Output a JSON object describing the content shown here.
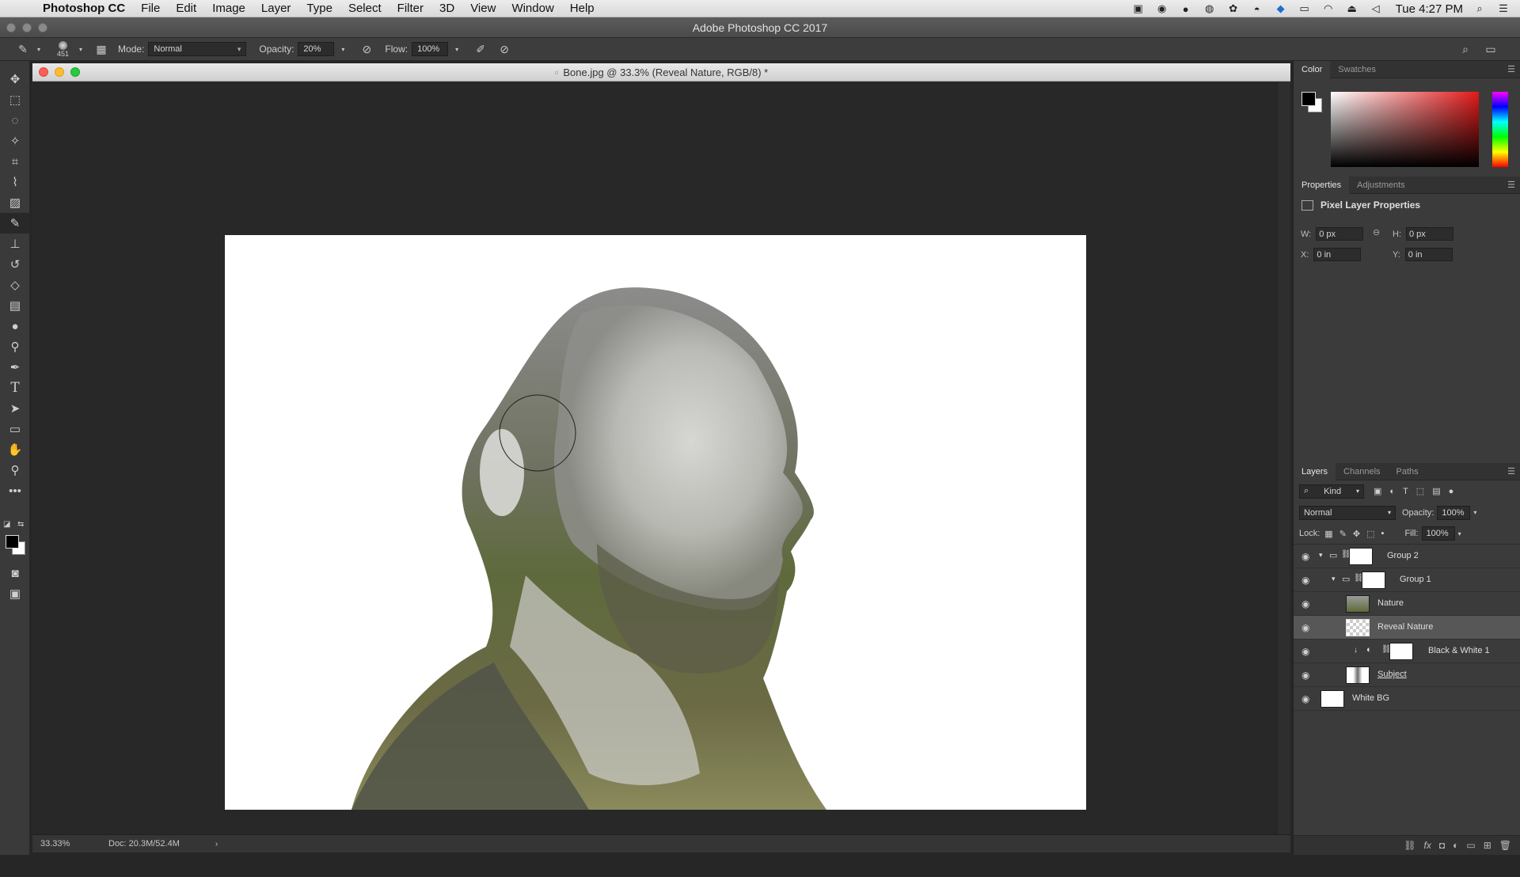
{
  "menubar": {
    "app_name": "Photoshop CC",
    "items": [
      "File",
      "Edit",
      "Image",
      "Layer",
      "Type",
      "Select",
      "Filter",
      "3D",
      "View",
      "Window",
      "Help"
    ],
    "clock": "Tue 4:27 PM"
  },
  "app_title": "Adobe Photoshop CC 2017",
  "options": {
    "brush_size": "451",
    "mode_label": "Mode:",
    "mode_value": "Normal",
    "opacity_label": "Opacity:",
    "opacity_value": "20%",
    "flow_label": "Flow:",
    "flow_value": "100%"
  },
  "document": {
    "title": "Bone.jpg @ 33.3% (Reveal Nature, RGB/8) *",
    "zoom": "33.33%",
    "doc_info": "Doc: 20.3M/52.4M"
  },
  "color_panel": {
    "tabs": [
      "Color",
      "Swatches"
    ],
    "foreground": "#000000",
    "background": "#ffffff"
  },
  "properties_panel": {
    "tabs": [
      "Properties",
      "Adjustments"
    ],
    "heading": "Pixel Layer Properties",
    "w_label": "W:",
    "w_value": "0 px",
    "h_label": "H:",
    "h_value": "0 px",
    "x_label": "X:",
    "x_value": "0 in",
    "y_label": "Y:",
    "y_value": "0 in"
  },
  "layers_panel": {
    "tabs": [
      "Layers",
      "Channels",
      "Paths"
    ],
    "filter_label": "Kind",
    "blend_mode": "Normal",
    "opacity_label": "Opacity:",
    "opacity_value": "100%",
    "lock_label": "Lock:",
    "fill_label": "Fill:",
    "fill_value": "100%",
    "layers": [
      {
        "name": "Group 2",
        "type": "group"
      },
      {
        "name": "Group 1",
        "type": "group"
      },
      {
        "name": "Nature",
        "type": "pixel"
      },
      {
        "name": "Reveal Nature",
        "type": "pixel",
        "selected": true
      },
      {
        "name": "Black & White 1",
        "type": "adjustment"
      },
      {
        "name": "Subject",
        "type": "pixel"
      },
      {
        "name": "White BG",
        "type": "pixel"
      }
    ]
  }
}
